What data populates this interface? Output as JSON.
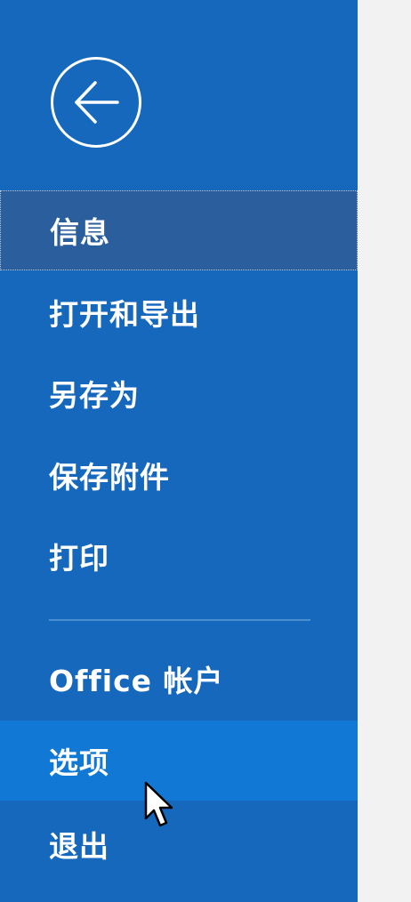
{
  "backstage": {
    "back_icon": "arrow-left-icon",
    "menu_items": [
      {
        "label": "信息",
        "state": "selected"
      },
      {
        "label": "打开和导出",
        "state": "normal"
      },
      {
        "label": "另存为",
        "state": "normal"
      },
      {
        "label": "保存附件",
        "state": "normal"
      },
      {
        "label": "打印",
        "state": "normal"
      },
      {
        "label": "Office 帐户",
        "state": "normal"
      },
      {
        "label": "选项",
        "state": "hover"
      },
      {
        "label": "退出",
        "state": "normal"
      }
    ]
  },
  "colors": {
    "sidebar_bg": "#1668bd",
    "selected_bg": "#2a5e9c",
    "hover_bg": "#1278d6",
    "content_bg": "#f2f2f2",
    "text": "#ffffff"
  },
  "cursor_icon": "mouse-pointer-icon"
}
